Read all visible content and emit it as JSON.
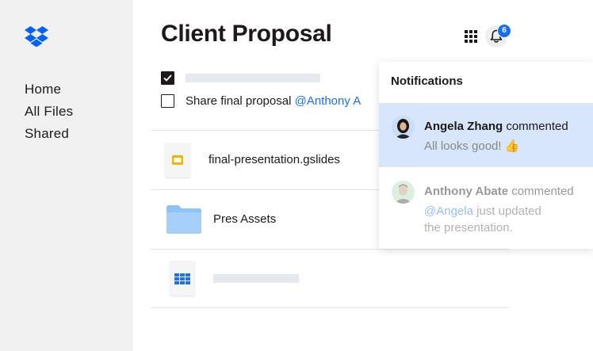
{
  "sidebar": {
    "logo": "dropbox-logo",
    "items": [
      {
        "label": "Home"
      },
      {
        "label": "All Files"
      },
      {
        "label": "Shared"
      }
    ]
  },
  "header": {
    "title": "Client Proposal",
    "apps_icon": "grid-icon",
    "bell_icon": "bell-icon",
    "notification_count": "6"
  },
  "tasks": [
    {
      "checked": true,
      "text": ""
    },
    {
      "checked": false,
      "text": "Share final proposal ",
      "mention": "@Anthony A"
    }
  ],
  "files": [
    {
      "name": "final-presentation.gslides",
      "icon": "gslides-icon"
    },
    {
      "name": "Pres Assets",
      "icon": "folder-icon"
    },
    {
      "name": "",
      "icon": "gsheets-icon"
    }
  ],
  "notifications": {
    "title": "Notifications",
    "items": [
      {
        "name": "Angela Zhang",
        "action": " commented",
        "message": "All looks good! 👍",
        "read": false
      },
      {
        "name": "Anthony Abate",
        "action": " commented",
        "mention": "@Angela",
        "message_rest": " just updated",
        "message_line2": "the presentation.",
        "read": true
      }
    ]
  },
  "colors": {
    "accent": "#1a6ef2",
    "sidebar_bg": "#f1f1f1",
    "highlight": "#d7e6fb"
  }
}
